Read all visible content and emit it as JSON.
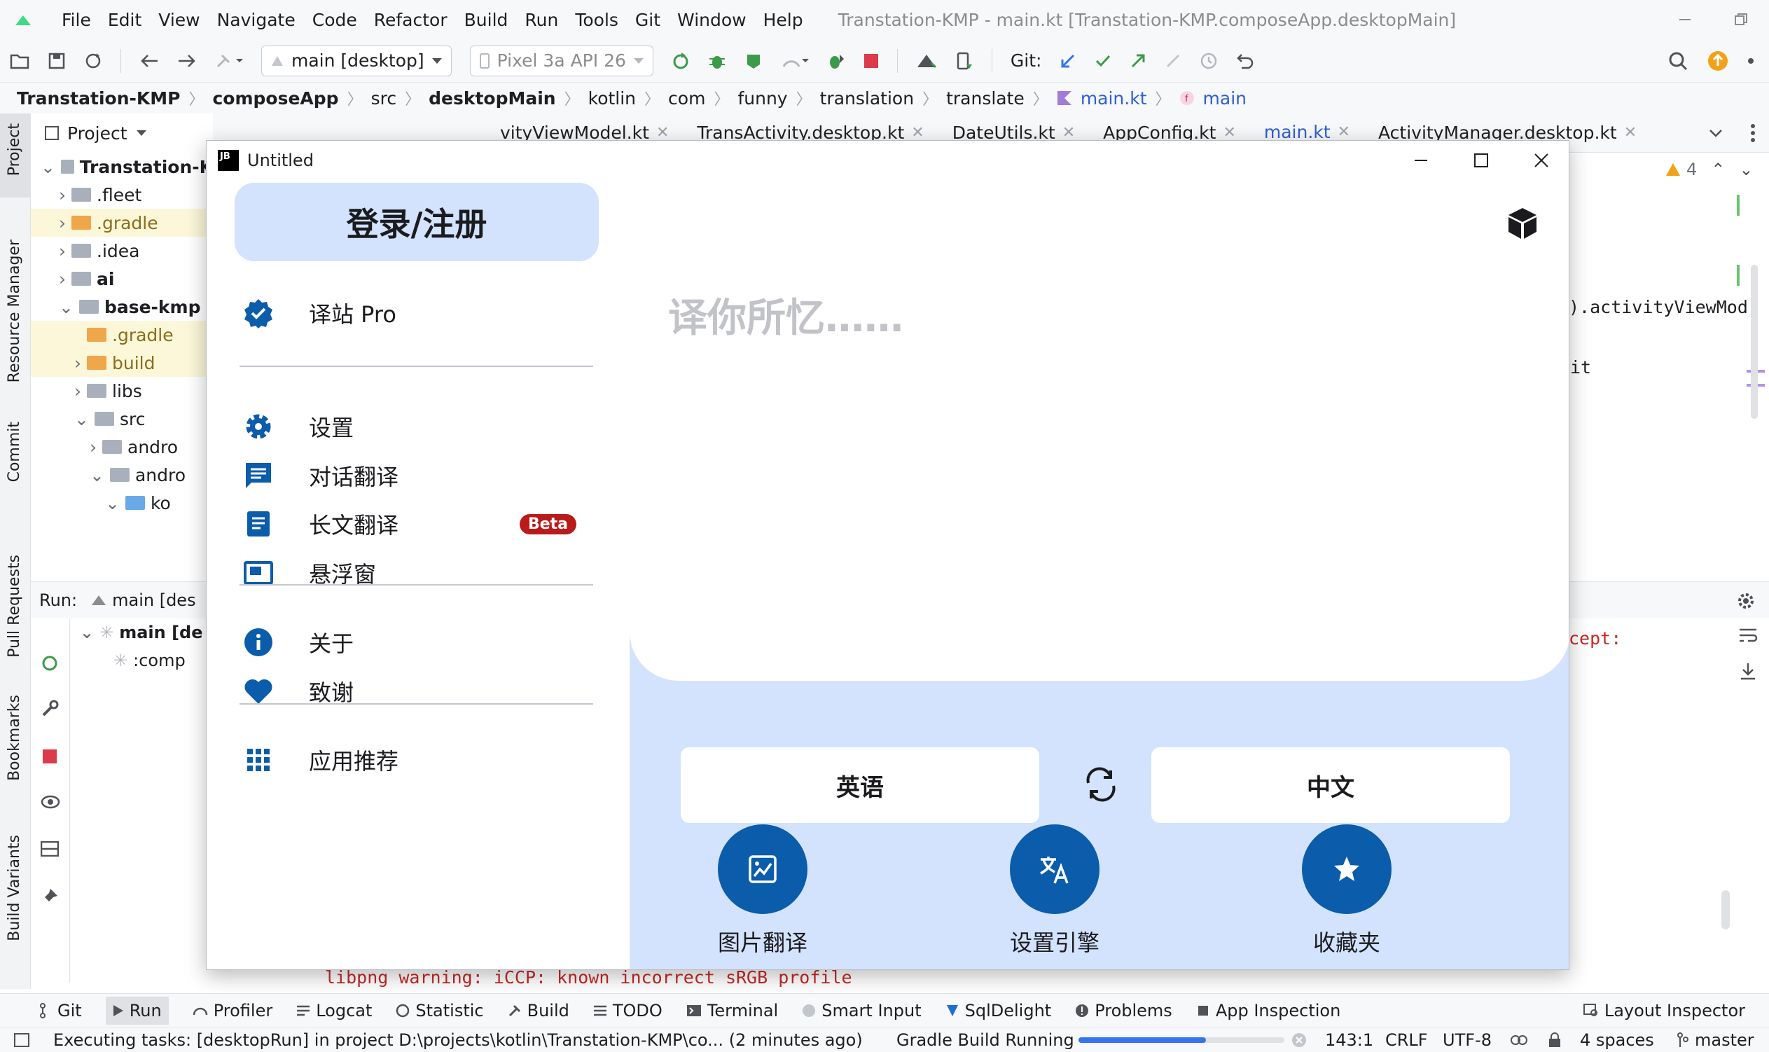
{
  "ide": {
    "menu": [
      "File",
      "Edit",
      "View",
      "Navigate",
      "Code",
      "Refactor",
      "Build",
      "Run",
      "Tools",
      "Git",
      "Window",
      "Help"
    ],
    "window_title": "Transtation-KMP - main.kt [Transtation-KMP.composeApp.desktopMain]",
    "toolbar": {
      "run_config": "main [desktop]",
      "device": "Pixel 3a API 26",
      "git_label": "Git:"
    },
    "breadcrumbs": [
      "Transtation-KMP",
      "composeApp",
      "src",
      "desktopMain",
      "kotlin",
      "com",
      "funny",
      "translation",
      "translate",
      "main.kt",
      "main"
    ],
    "left_tabs": [
      "Project",
      "Resource Manager",
      "Commit",
      "Pull Requests",
      "Bookmarks",
      "Build Variants"
    ],
    "project_panel": {
      "title": "Project",
      "tree": [
        {
          "label": "Transtation-K",
          "bold": true
        },
        {
          "label": ".fleet"
        },
        {
          "label": ".gradle"
        },
        {
          "label": ".idea"
        },
        {
          "label": "ai",
          "bold": true
        },
        {
          "label": "base-kmp",
          "bold": true
        },
        {
          "label": ".gradle"
        },
        {
          "label": "build"
        },
        {
          "label": "libs"
        },
        {
          "label": "src"
        },
        {
          "label": "andro"
        },
        {
          "label": "andro"
        },
        {
          "label": "ko"
        }
      ]
    },
    "editor_tabs": [
      "vityViewModel.kt",
      "TransActivity.desktop.kt",
      "DateUtils.kt",
      "AppConfig.kt",
      "main.kt",
      "ActivityManager.desktop.kt"
    ],
    "editor": {
      "warnings": "4",
      "code_lines": [
        ").activityViewMod",
        "it"
      ]
    },
    "run_panel": {
      "label": "Run:",
      "config": "main [des",
      "tree": [
        "main [de",
        ":comp"
      ],
      "console_right": "cept:",
      "console_line": "libpng warning: iCCP: known incorrect sRGB profile"
    },
    "bottom_tabs": [
      "Git",
      "Run",
      "Profiler",
      "Logcat",
      "Statistic",
      "Build",
      "TODO",
      "Terminal",
      "Smart Input",
      "SqlDelight",
      "Problems",
      "App Inspection",
      "Layout Inspector"
    ],
    "status": {
      "message": "Executing tasks: [desktopRun] in project D:\\projects\\kotlin\\Transtation-KMP\\co... (2 minutes ago)",
      "progress_label": "Gradle Build Running",
      "progress_fraction": 0.62,
      "position": "143:1",
      "line_sep": "CRLF",
      "encoding": "UTF-8",
      "indent": "4 spaces",
      "branch": "master"
    }
  },
  "app": {
    "title": "Untitled",
    "logo_text": "JB",
    "drawer": {
      "header": "登录/注册",
      "items": [
        {
          "label": "译站 Pro",
          "icon": "verified-badge-icon"
        },
        {
          "label": "设置",
          "icon": "gear-icon"
        },
        {
          "label": "对话翻译",
          "icon": "chat-icon"
        },
        {
          "label": "长文翻译",
          "icon": "article-icon",
          "badge": "Beta"
        },
        {
          "label": "悬浮窗",
          "icon": "floating-window-icon"
        },
        {
          "label": "关于",
          "icon": "info-icon"
        },
        {
          "label": "致谢",
          "icon": "heart-icon"
        },
        {
          "label": "应用推荐",
          "icon": "apps-grid-icon"
        }
      ]
    },
    "input_placeholder": "译你所忆……",
    "source_lang": "英语",
    "target_lang": "中文",
    "actions": [
      {
        "label": "图片翻译",
        "icon": "image-translate-icon"
      },
      {
        "label": "设置引擎",
        "icon": "translate-engine-icon"
      },
      {
        "label": "收藏夹",
        "icon": "star-icon"
      }
    ],
    "colors": {
      "primary": "#0b5cab",
      "container": "#d3e3fd",
      "badge": "#ba1a1a"
    }
  }
}
